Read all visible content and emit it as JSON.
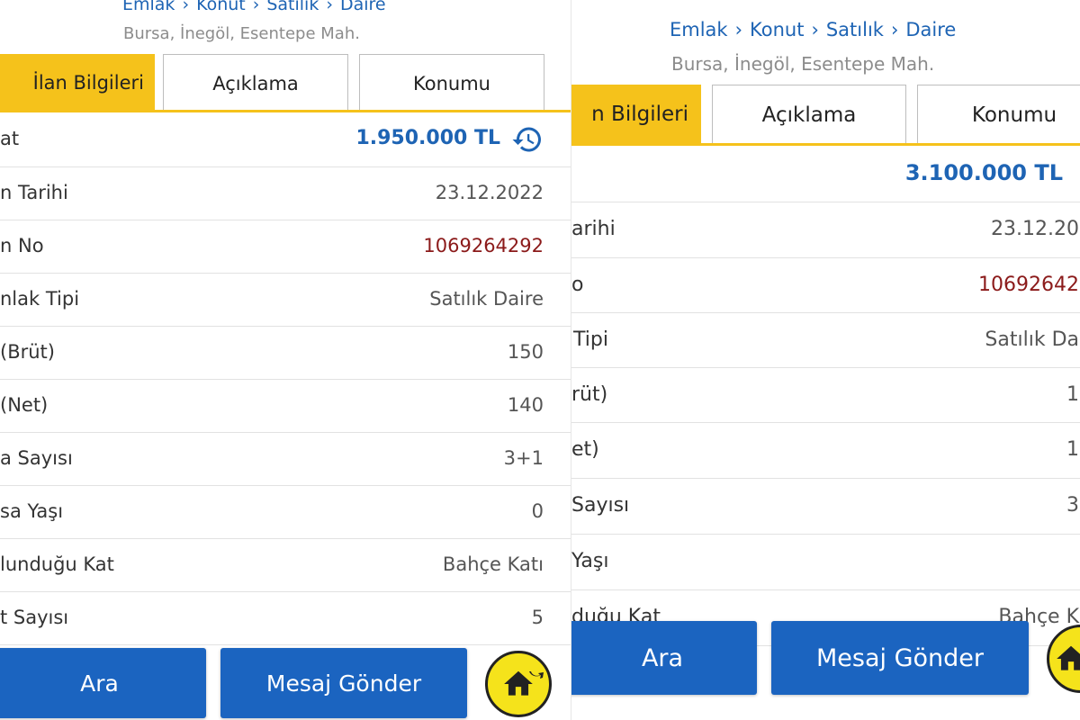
{
  "left": {
    "breadcrumb": [
      "Emlak",
      "Konut",
      "Satılık",
      "Daire"
    ],
    "breadcrumb_sep": "›",
    "location": "Bursa, İnegöl, Esentepe Mah.",
    "tabs": [
      "İlan Bilgileri",
      "Açıklama",
      "Konumu"
    ],
    "rows": [
      {
        "label": "at",
        "value": "1.950.000 TL"
      },
      {
        "label": "n Tarihi",
        "value": "23.12.2022"
      },
      {
        "label": "n No",
        "value": "1069264292"
      },
      {
        "label": "nlak Tipi",
        "value": "Satılık Daire"
      },
      {
        "label": "(Brüt)",
        "value": "150"
      },
      {
        "label": "(Net)",
        "value": "140"
      },
      {
        "label": "a Sayısı",
        "value": "3+1"
      },
      {
        "label": "sa Yaşı",
        "value": "0"
      },
      {
        "label": "lunduğu Kat",
        "value": "Bahçe Katı"
      },
      {
        "label": "t Sayısı",
        "value": "5"
      }
    ],
    "buttons": {
      "call": "Ara",
      "message": "Mesaj Gönder"
    }
  },
  "right": {
    "breadcrumb": [
      "Emlak",
      "Konut",
      "Satılık",
      "Daire"
    ],
    "breadcrumb_sep": "›",
    "location": "Bursa, İnegöl, Esentepe Mah.",
    "tabs": [
      "n Bilgileri",
      "Açıklama",
      "Konumu"
    ],
    "rows": [
      {
        "label": "",
        "value": "3.100.000 TL"
      },
      {
        "label": "arihi",
        "value": "23.12.20"
      },
      {
        "label": "o",
        "value": "10692642"
      },
      {
        "label": "Tipi",
        "value": "Satılık Da"
      },
      {
        "label": "rüt)",
        "value": "1"
      },
      {
        "label": "et)",
        "value": "1"
      },
      {
        "label": "Sayısı",
        "value": "3"
      },
      {
        "label": "Yaşı",
        "value": ""
      },
      {
        "label": "duğu Kat",
        "value": "Bahçe K"
      }
    ],
    "buttons": {
      "call": "Ara",
      "message": "Mesaj Gönder"
    }
  },
  "colors": {
    "accent_yellow": "#f5c21b",
    "primary_blue": "#1b64c0",
    "link_blue": "#1e64b4",
    "listing_red": "#8b1a1a",
    "fab_yellow": "#f5e31b"
  },
  "icons": {
    "price_history": "history-icon",
    "home": "home-icon"
  }
}
